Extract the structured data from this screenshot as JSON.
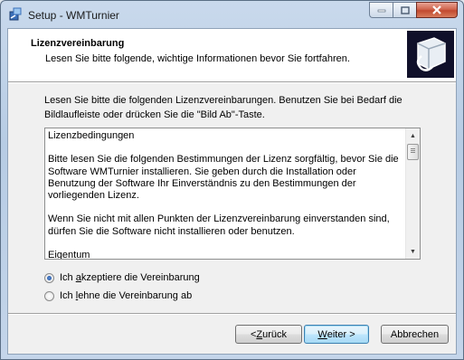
{
  "window": {
    "title": "Setup - WMTurnier",
    "accent": "#c24a30",
    "icon": "setup-app-icon"
  },
  "header": {
    "title": "Lizenzvereinbarung",
    "subtitle": "Lesen Sie bitte folgende, wichtige Informationen bevor Sie fortfahren.",
    "logo_icon": "installer-box-icon"
  },
  "intro": "Lesen Sie bitte die folgenden Lizenzvereinbarungen. Benutzen Sie bei Bedarf die Bildlaufleiste oder drücken Sie die \"Bild Ab\"-Taste.",
  "license": {
    "text": "Lizenzbedingungen\n\nBitte lesen Sie die folgenden Bestimmungen der Lizenz sorgfältig, bevor Sie die Software WMTurnier installieren. Sie geben durch die Installation oder Benutzung der Software Ihr Einverständnis zu den Bestimmungen der vorliegenden Lizenz.\n\nWenn Sie nicht mit allen Punkten der Lizenzvereinbarung einverstanden sind, dürfen Sie die Software nicht installieren oder benutzen.\n\nEigentum"
  },
  "options": [
    {
      "pre": "Ich ",
      "key": "a",
      "post": "kzeptiere die Vereinbarung",
      "checked": true
    },
    {
      "pre": "Ich ",
      "key": "l",
      "post": "ehne die Vereinbarung ab",
      "checked": false
    }
  ],
  "buttons": {
    "back": {
      "pre": "< ",
      "key": "Z",
      "post": "urück"
    },
    "next": {
      "pre": "",
      "key": "W",
      "post": "eiter >"
    },
    "cancel": "Abbrechen"
  }
}
